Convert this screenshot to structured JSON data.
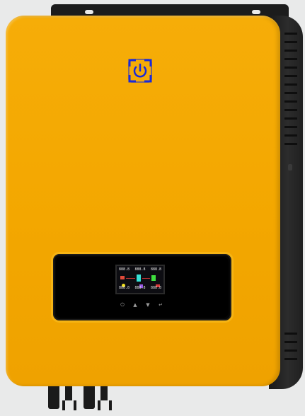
{
  "device": {
    "type": "solar-hybrid-inverter",
    "colors": {
      "cover": "#f3a700",
      "panel_frame": "#f6b414",
      "chassis": "#222222",
      "logo": "#1a2bd8"
    },
    "power_logo_icon": "power-icon"
  },
  "display": {
    "top_row": [
      "888.8",
      "888.8",
      "888.8"
    ],
    "bottom_row": [
      "888.8",
      "888.8",
      "888.8"
    ]
  },
  "keys": [
    {
      "icon": "power-icon",
      "glyph": "⏻"
    },
    {
      "icon": "up-arrow-icon",
      "glyph": "▲"
    },
    {
      "icon": "down-arrow-icon",
      "glyph": "▼"
    },
    {
      "icon": "enter-icon",
      "glyph": "↵"
    }
  ]
}
